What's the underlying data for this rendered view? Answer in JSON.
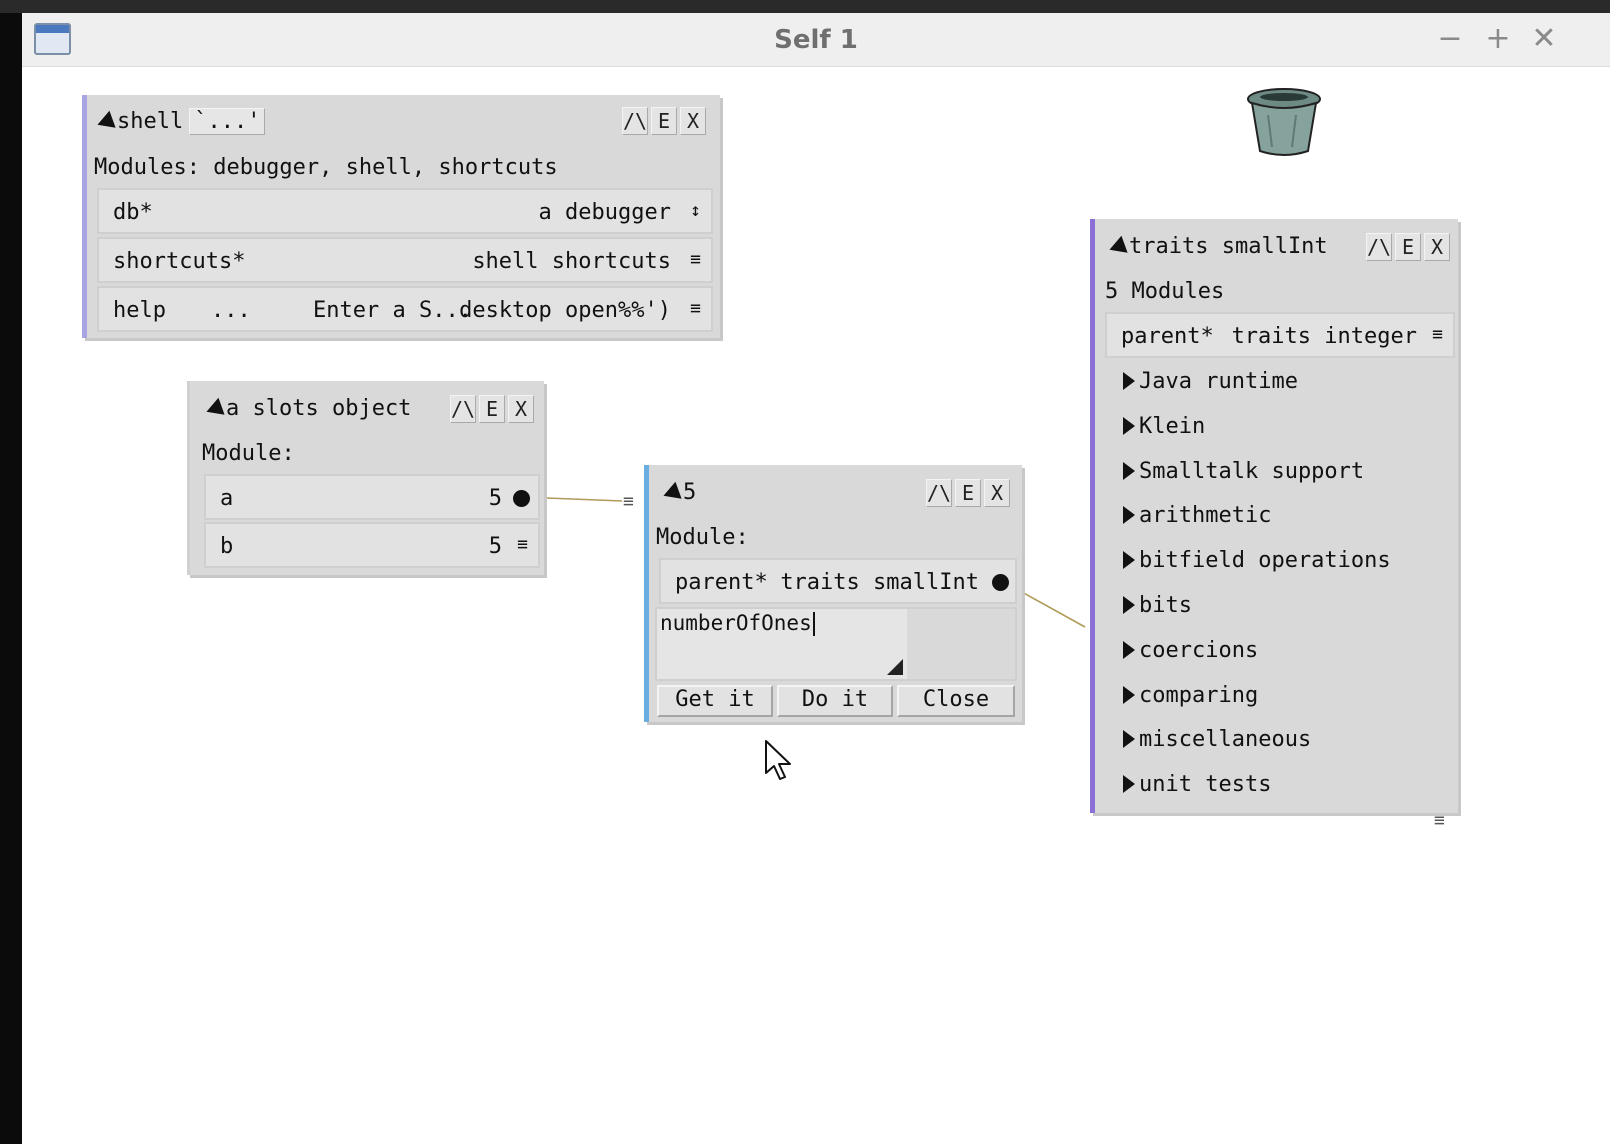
{
  "window": {
    "title": "Self 1",
    "minimize_label": "−",
    "maximize_label": "+",
    "close_label": "✕"
  },
  "ctrl_labels": {
    "up": "/\\",
    "edit": "E",
    "close": "X"
  },
  "shell": {
    "title": "shell",
    "quote_label": "`...'",
    "modules_text": "Modules:  debugger, shell, shortcuts",
    "rows": [
      {
        "name": "db*",
        "value": "a debugger"
      },
      {
        "name": "shortcuts*",
        "value": "shell shortcuts"
      },
      {
        "name": "help",
        "mid": "...",
        "hint": "Enter a S...",
        "value": "desktop open%%')"
      }
    ]
  },
  "slots_object": {
    "title": "a slots object",
    "module_text": "Module:",
    "rows": [
      {
        "name": "a",
        "value": "5"
      },
      {
        "name": "b",
        "value": "5"
      }
    ]
  },
  "five": {
    "title": "5",
    "module_text": "Module:",
    "parent_name": "parent*",
    "parent_value": "traits smallInt",
    "editor_text": "numberOfOnes",
    "buttons": {
      "get": "Get it",
      "do": "Do it",
      "close": "Close"
    }
  },
  "traits_smallint": {
    "title": "traits smallInt",
    "modules_text": "5 Modules",
    "parent_name": "parent*",
    "parent_value": "traits integer",
    "categories": [
      "Java runtime",
      "Klein",
      "Smalltalk support",
      "arithmetic",
      "bitfield operations",
      "bits",
      "coercions",
      "comparing",
      "miscellaneous",
      "unit tests"
    ]
  }
}
